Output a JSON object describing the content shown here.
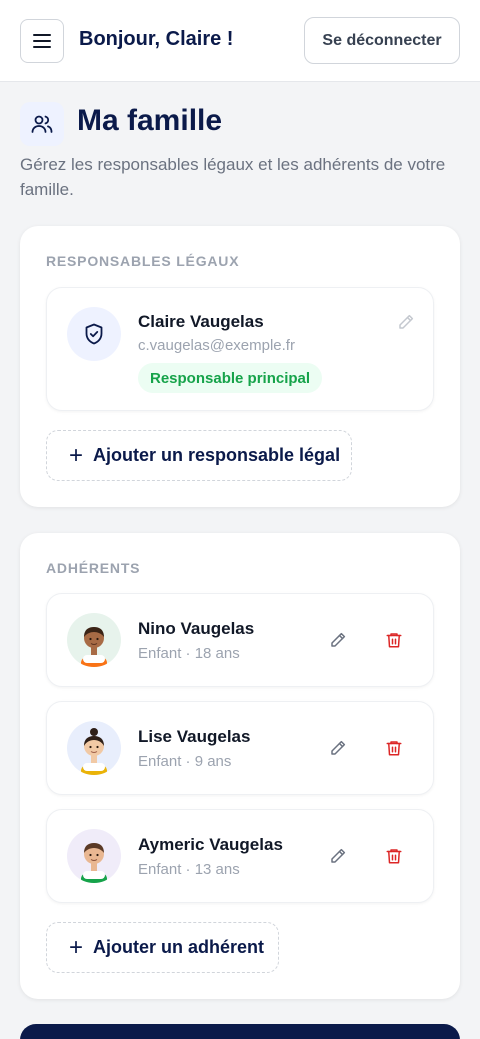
{
  "header": {
    "greeting": "Bonjour, Claire !",
    "logout_label": "Se déconnecter"
  },
  "page": {
    "title": "Ma famille",
    "description": "Gérez les responsables légaux et les adhérents de votre famille."
  },
  "guardians": {
    "section_title": "RESPONSABLES LÉGAUX",
    "items": [
      {
        "name": "Claire Vaugelas",
        "email": "c.vaugelas@exemple.fr",
        "badge": "Responsable principal"
      }
    ],
    "add_label": "Ajouter un responsable légal"
  },
  "members": {
    "section_title": "ADHÉRENTS",
    "items": [
      {
        "name": "Nino Vaugelas",
        "detail": "Enfant · 18 ans"
      },
      {
        "name": "Lise Vaugelas",
        "detail": "Enfant · 9 ans"
      },
      {
        "name": "Aymeric Vaugelas",
        "detail": "Enfant · 13 ans"
      }
    ],
    "add_label": "Ajouter un adhérent"
  },
  "colors": {
    "brand": "#0b1a4a",
    "badge_text": "#16a34a",
    "badge_bg": "#ecfdf3",
    "danger": "#dc2626"
  },
  "icons": [
    "menu-icon",
    "users-icon",
    "shield-check-icon",
    "pencil-icon",
    "trash-icon",
    "plus-icon"
  ]
}
